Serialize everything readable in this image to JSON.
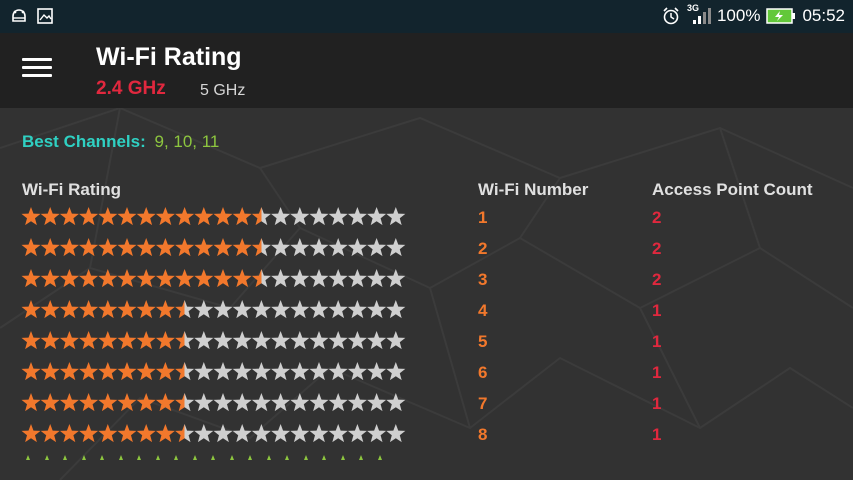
{
  "status_bar": {
    "network": "3G",
    "battery": "100%",
    "time": "05:52"
  },
  "app_bar": {
    "title": "Wi-Fi Rating",
    "tabs": [
      {
        "label": "2.4 GHz",
        "active": true
      },
      {
        "label": "5 GHz",
        "active": false
      }
    ]
  },
  "best_channels": {
    "label": "Best Channels:",
    "value": "9, 10, 11"
  },
  "table": {
    "headers": [
      "Wi-Fi Rating",
      "Wi-Fi Number",
      "Access Point Count"
    ],
    "max_stars": 20,
    "rows": [
      {
        "stars": 12.5,
        "number": "1",
        "count": "2"
      },
      {
        "stars": 12.5,
        "number": "2",
        "count": "2"
      },
      {
        "stars": 12.5,
        "number": "3",
        "count": "2"
      },
      {
        "stars": 8.5,
        "number": "4",
        "count": "1"
      },
      {
        "stars": 8.5,
        "number": "5",
        "count": "1"
      },
      {
        "stars": 8.5,
        "number": "6",
        "count": "1"
      },
      {
        "stars": 8.5,
        "number": "7",
        "count": "1"
      },
      {
        "stars": 8.5,
        "number": "8",
        "count": "1"
      }
    ]
  },
  "colors": {
    "star_filled": "#f2782c",
    "star_empty": "#cfcfcf",
    "best_label": "#2fd0c2",
    "best_value": "#8dc63f",
    "accent_red": "#e0283e"
  }
}
